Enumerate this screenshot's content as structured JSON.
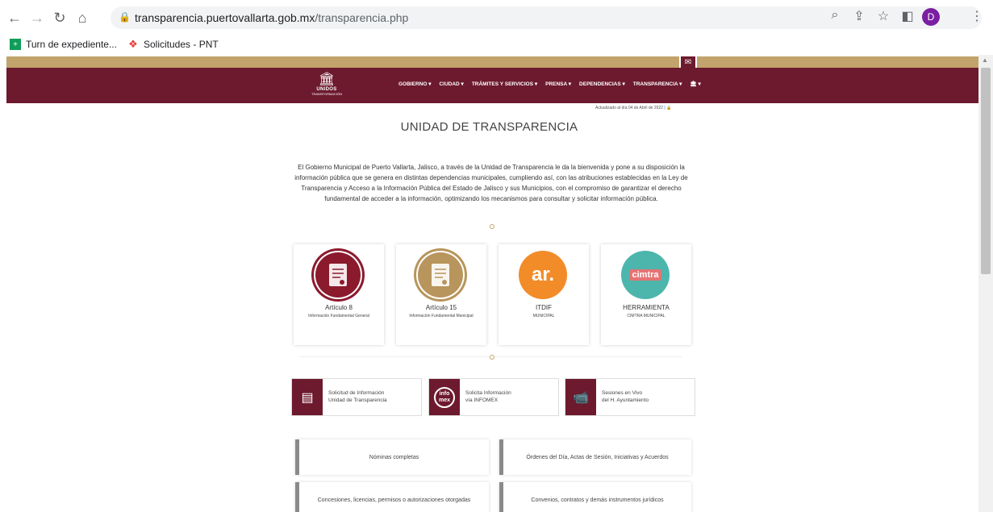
{
  "browser": {
    "url_domain": "transparencia.puertovallarta.gob.mx",
    "url_path": "/transparencia.php",
    "profile_initial": "D",
    "bookmarks": [
      {
        "label": "Turn de expediente...",
        "icon": "sheets-icon",
        "color": "#0f9d58"
      },
      {
        "label": "Solicitudes - PNT",
        "icon": "pnt-icon",
        "color": "#e53935"
      }
    ]
  },
  "site": {
    "logo_line1": "UNIDOS",
    "logo_line2": "TRANSFORMACIÓN",
    "logo_small": "por la",
    "menu": [
      "GOBIERNO ▾",
      "CIUDAD ▾",
      "TRÁMITES Y SERVICIOS ▾",
      "PRENSA ▾",
      "DEPENDENCIAS ▾",
      "TRANSPARENCIA ▾",
      "🏛 ▾"
    ],
    "updated": "Actualizado al día 04 de Abril de 2022",
    "updated_link": "| 🔒",
    "title": "UNIDAD DE TRANSPARENCIA",
    "intro": "El Gobierno Municipal de Puerto Vallarta, Jalisco, a través de la Unidad de Transparencia le da la bienvenida y pone a su disposición la información pública que se genera en distintas dependencias municipales, cumpliendo así, con las atribuciones establecidas en la Ley de Transparencia y Acceso a la Información Pública del Estado de Jalisco y sus Municipios, con el compromiso de garantizar el derecho fundamental de acceder a la información, optimizando los mecanismos para consultar y solicitar información pública."
  },
  "cards": [
    {
      "title": "Artículo 8",
      "sub": "Información Fundamental General",
      "color": "#8b1a2d"
    },
    {
      "title": "Artículo 15",
      "sub": "Información Fundamental Municipal",
      "color": "#b8955c"
    },
    {
      "title": "ITDIF",
      "sub": "MUNICIPAL",
      "color": "#f28c28",
      "logo": "ar."
    },
    {
      "title": "HERRAMIENTA",
      "sub": "CIMTRA MUNICIPAL",
      "color": "#4db6ac",
      "logo": "cimtra"
    }
  ],
  "buttons": [
    {
      "line1": "Solicitud de Información",
      "line2": "Unidad de Transparencia",
      "icon": "document-icon"
    },
    {
      "line1": "Solicita Información",
      "line2": "vía INFOMEX",
      "icon": "infomex-icon",
      "logo": "info mex"
    },
    {
      "line1": "Sesiones en Vivo",
      "line2": "del H. Ayuntamiento",
      "icon": "video-icon"
    }
  ],
  "links": [
    "Nóminas completas",
    "Órdenes del Día, Actas de Sesión, Iniciativas y Acuerdos",
    "Concesiones, licencias, permisos o autorizaciones otorgadas",
    "Convenios, contratos y demás instrumentos jurídicos"
  ]
}
